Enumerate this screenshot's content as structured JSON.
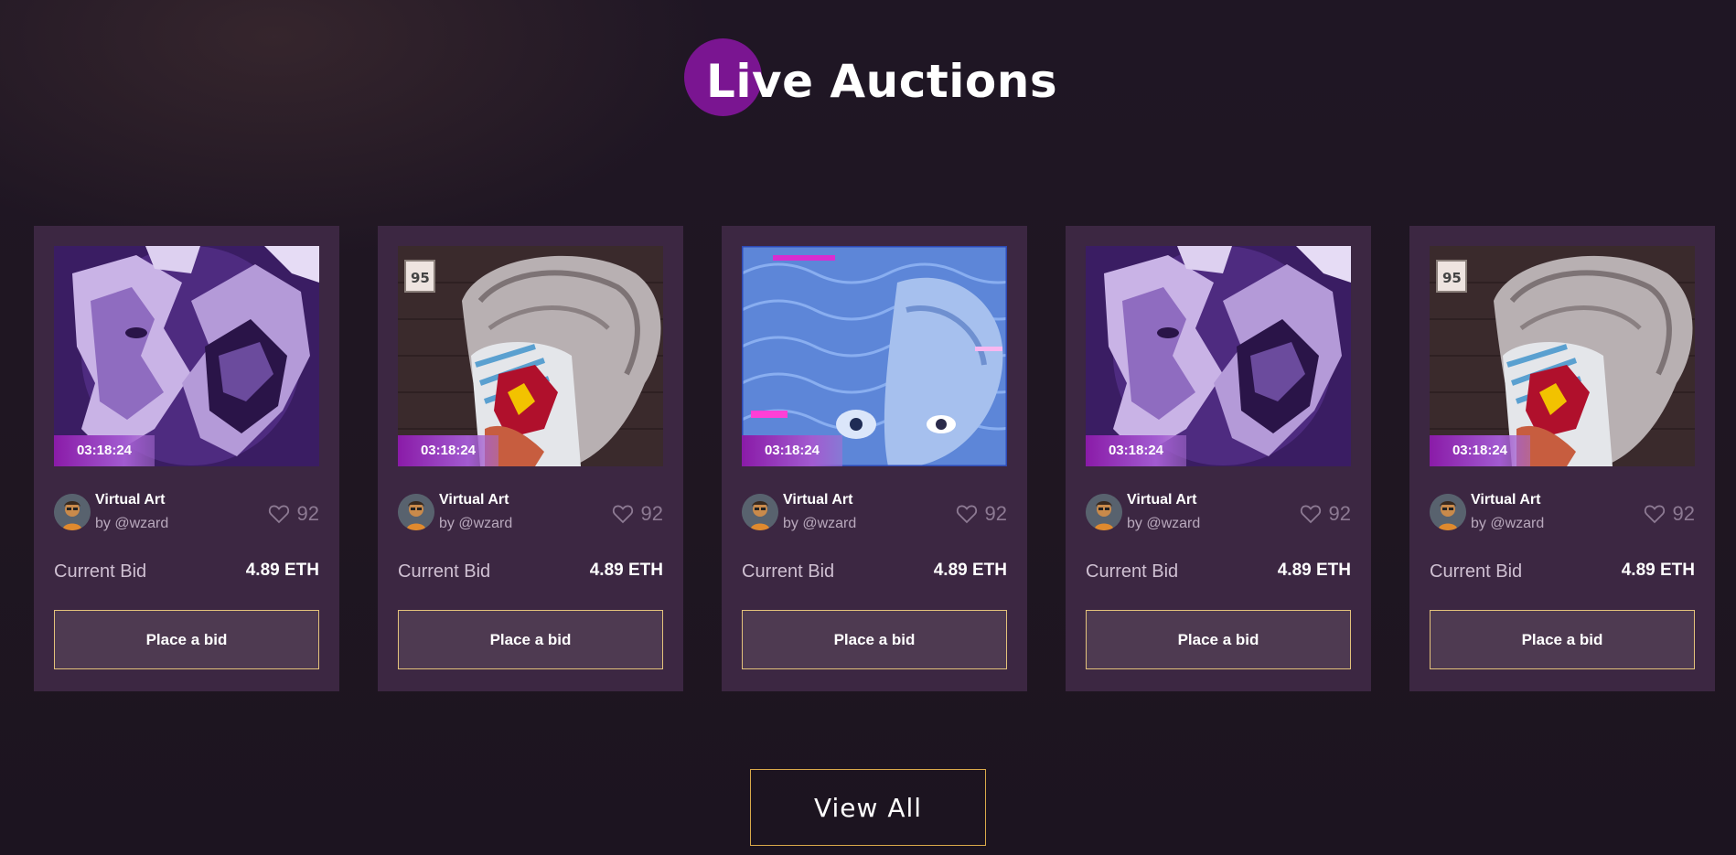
{
  "section": {
    "title": "Live Auctions",
    "accent_color": "#7a1591"
  },
  "cards": [
    {
      "art": "purple-faces",
      "timer": "03:18:24",
      "name": "Virtual Art",
      "creator": "by @wzard",
      "likes": "92",
      "bid_label": "Current Bid",
      "bid_value": "4.89 ETH",
      "button": "Place a bid"
    },
    {
      "art": "statue-collage",
      "timer": "03:18:24",
      "name": "Virtual Art",
      "creator": "by @wzard",
      "likes": "92",
      "bid_label": "Current Bid",
      "bid_value": "4.89 ETH",
      "button": "Place a bid"
    },
    {
      "art": "blue-glitch-statue",
      "timer": "03:18:24",
      "name": "Virtual Art",
      "creator": "by @wzard",
      "likes": "92",
      "bid_label": "Current Bid",
      "bid_value": "4.89 ETH",
      "button": "Place a bid"
    },
    {
      "art": "purple-faces",
      "timer": "03:18:24",
      "name": "Virtual Art",
      "creator": "by @wzard",
      "likes": "92",
      "bid_label": "Current Bid",
      "bid_value": "4.89 ETH",
      "button": "Place a bid"
    },
    {
      "art": "statue-collage",
      "timer": "03:18:24",
      "name": "Virtual Art",
      "creator": "by @wzard",
      "likes": "92",
      "bid_label": "Current Bid",
      "bid_value": "4.89 ETH",
      "button": "Place a bid"
    }
  ],
  "art_badge": "95",
  "icons": {
    "like": "heart-icon",
    "avatar": "avatar"
  },
  "colors": {
    "background": "#1f1624",
    "card": "#3c2742",
    "button_bg": "#4e3a51",
    "button_border": "#e3c27b",
    "timer_gradient_start": "#8a1ba8"
  },
  "view_all_label": "View All"
}
